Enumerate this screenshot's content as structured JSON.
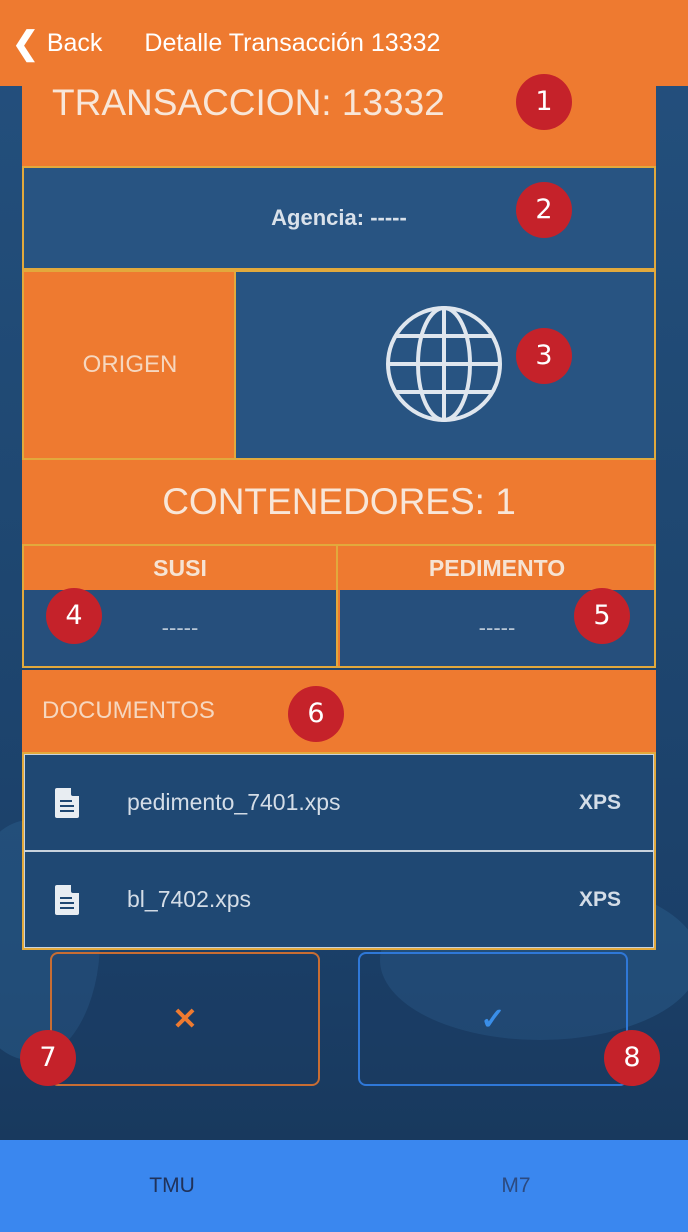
{
  "header": {
    "back_label": "Back",
    "title": "Detalle Transacción 13332"
  },
  "transaction_title": "TRANSACCION: 13332",
  "agencia": "Agencia: -----",
  "origen_label": "ORIGEN",
  "origen_icon": "globe-icon",
  "contenedores": "CONTENEDORES: 1",
  "susi": {
    "header": "SUSI",
    "value": "-----"
  },
  "pedimento": {
    "header": "PEDIMENTO",
    "value": "-----"
  },
  "documentos_label": "DOCUMENTOS",
  "files": [
    {
      "name": "pedimento_7401.xps",
      "type": "XPS",
      "icon": "document-icon"
    },
    {
      "name": "bl_7402.xps",
      "type": "XPS",
      "icon": "document-icon"
    }
  ],
  "buttons": {
    "cancel_symbol": "✕",
    "confirm_symbol": "✓"
  },
  "badges": [
    "1",
    "2",
    "3",
    "4",
    "5",
    "6",
    "7",
    "8"
  ],
  "tabs": [
    {
      "label": "TMU"
    },
    {
      "label": "M7"
    }
  ],
  "colors": {
    "accent_orange": "#ee7a30",
    "panel_blue": "#285482",
    "border_gold": "#e2a93c",
    "tab_blue": "#3a87ef",
    "badge_red": "#c5222a"
  }
}
